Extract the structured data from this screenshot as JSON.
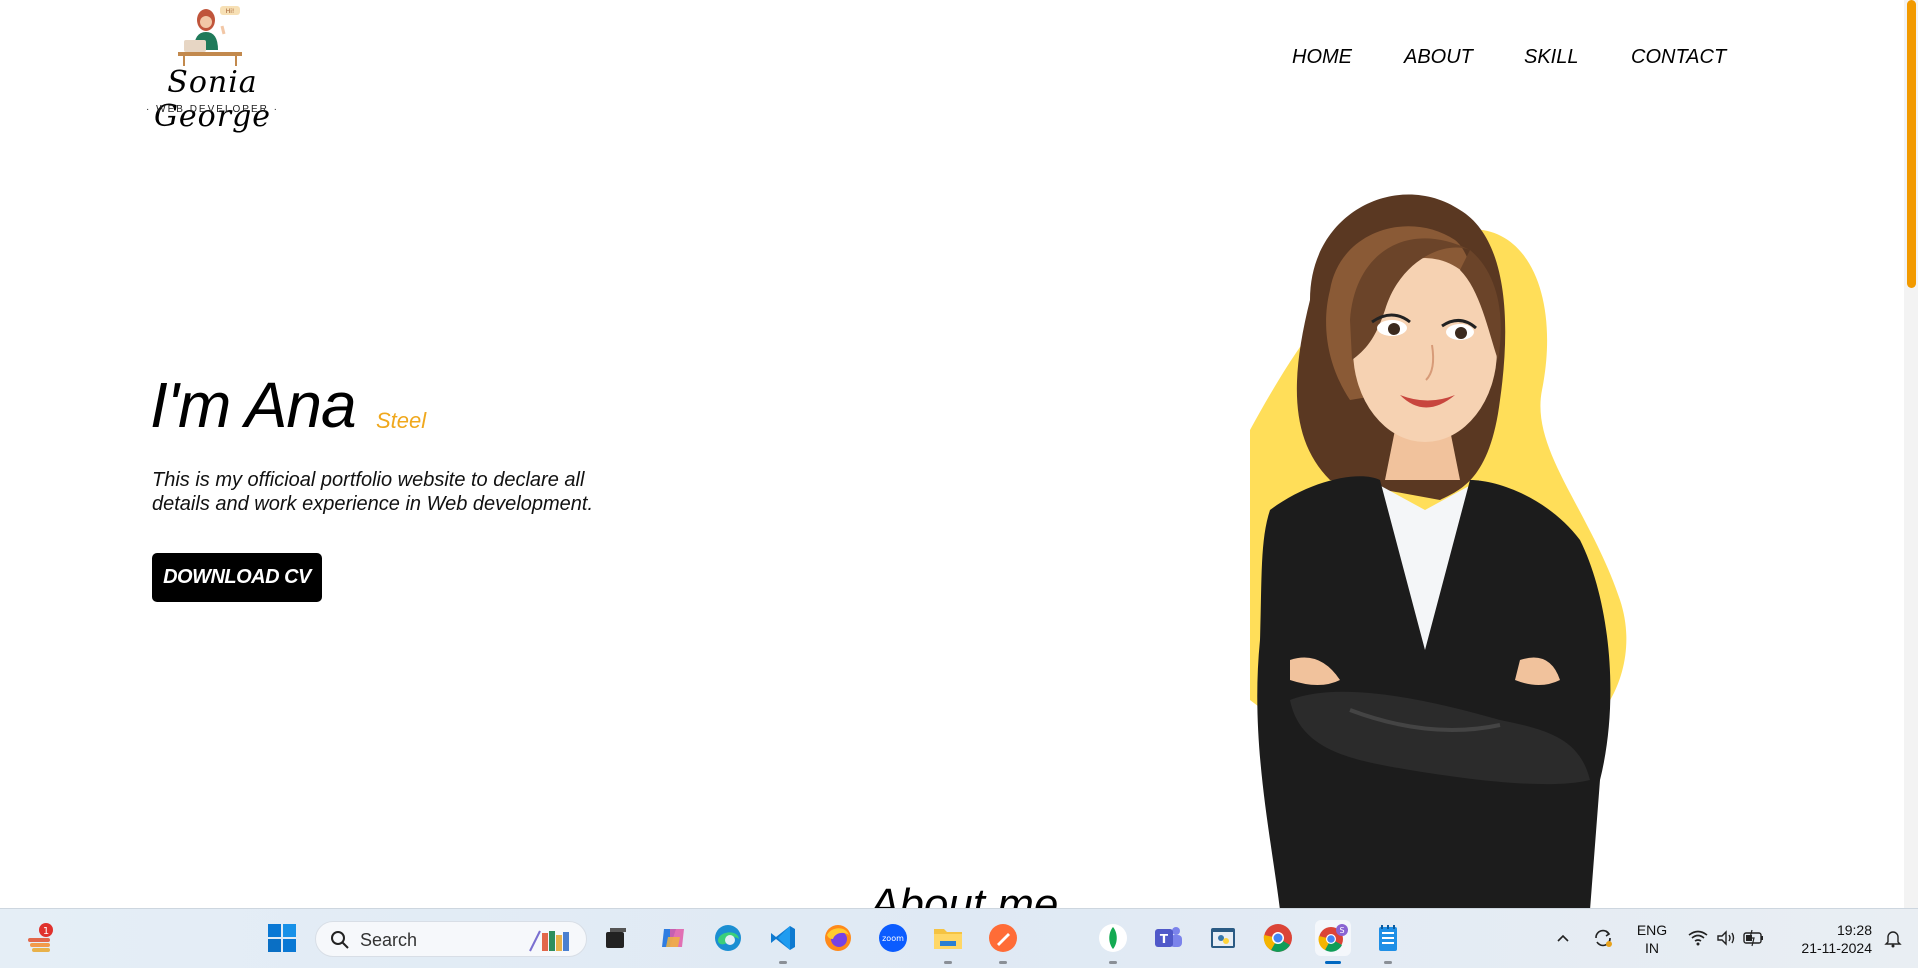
{
  "logo": {
    "name": "Sonia George",
    "subtitle": "· WEB DEVELOPER ·",
    "bubble": "Hi!"
  },
  "nav": {
    "items": [
      "HOME",
      "ABOUT",
      "SKILL",
      "CONTACT"
    ]
  },
  "hero": {
    "title": "I'm Ana",
    "accent": "Steel",
    "description": "This is my officioal portfolio website to declare all details and work experience in Web development.",
    "cta": "DOWNLOAD CV"
  },
  "sections": {
    "about_title": "About me"
  },
  "colors": {
    "accent": "#f0a81d",
    "scroll_thumb": "#f29a00",
    "blob": "#ffde59",
    "button_bg": "#000000"
  },
  "taskbar": {
    "widget_badge": "1",
    "search_placeholder": "Search",
    "chrome_profile": "S",
    "language": "ENG",
    "region": "IN",
    "time": "19:28",
    "date": "21-11-2024",
    "apps": [
      "weather-widget",
      "start",
      "search",
      "task-view",
      "copilot",
      "edge",
      "vscode",
      "firefox",
      "zoom",
      "file-explorer",
      "postman",
      "mongodb-compass",
      "teams",
      "python-idle",
      "chrome",
      "chrome-profile",
      "notepad"
    ]
  }
}
